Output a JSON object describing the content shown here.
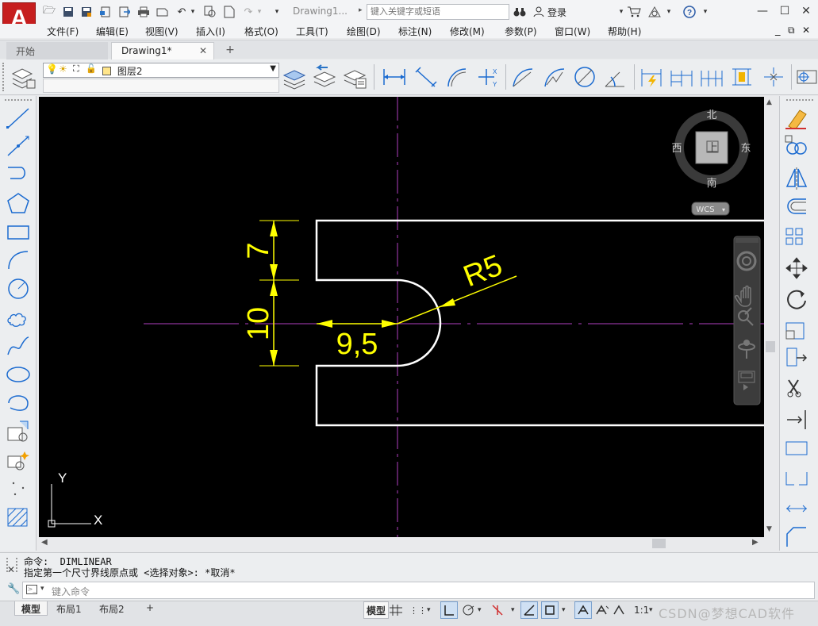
{
  "app": {
    "logo_letter": "A",
    "doc_title": "Drawing1...",
    "search_placeholder": "键入关键字或短语",
    "login_label": "登录"
  },
  "menus": [
    "文件(F)",
    "编辑(E)",
    "视图(V)",
    "插入(I)",
    "格式(O)",
    "工具(T)",
    "绘图(D)",
    "标注(N)",
    "修改(M)",
    "参数(P)",
    "窗口(W)",
    "帮助(H)"
  ],
  "tabs": {
    "start": "开始",
    "drawing": "Drawing1*",
    "close": "✕",
    "add": "+"
  },
  "layer": {
    "current": "图层2",
    "color": "#ffe58a"
  },
  "viewcube": {
    "north": "北",
    "south": "南",
    "east": "东",
    "west": "西",
    "face": "上",
    "wcs": "WCS"
  },
  "drawing": {
    "dim_height_top": "7",
    "dim_height_mid": "10",
    "dim_radius": "R5",
    "dim_length": "9,5",
    "ucs_x": "X",
    "ucs_y": "Y",
    "colors": {
      "geometry": "#ffffff",
      "dimension": "#ffff00",
      "centerline": "#b040c0",
      "background": "#000000"
    }
  },
  "command": {
    "history": [
      "命令:  DIMLINEAR",
      "指定第一个尺寸界线原点或 <选择对象>: *取消*"
    ],
    "placeholder": "键入命令"
  },
  "layout_tabs": [
    "模型",
    "布局1",
    "布局2",
    "+"
  ],
  "status": {
    "model_label": "模型",
    "scale": "1:1"
  },
  "watermark": "CSDN@梦想CAD软件"
}
